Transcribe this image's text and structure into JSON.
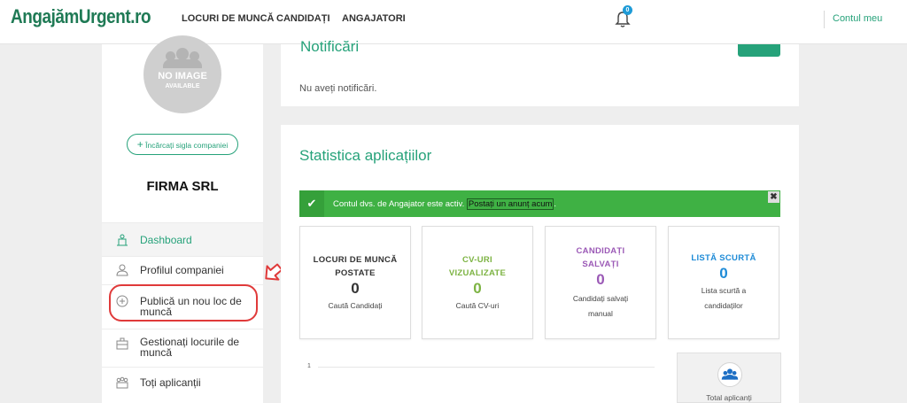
{
  "header": {
    "logo": "AngajămUrgent.ro",
    "nav": [
      "LOCURI DE MUNCĂ",
      "CANDIDAȚI",
      "ANGAJATORI"
    ],
    "notification_count": "0",
    "account": "Contul meu"
  },
  "sidebar": {
    "avatar_line1": "NO IMAGE",
    "avatar_line2": "AVAILABLE",
    "upload_button": "Încărcați sigla companiei",
    "company_name": "FIRMA SRL",
    "items": [
      {
        "label": "Dashboard",
        "icon": "dashboard-icon"
      },
      {
        "label": "Profilul companiei",
        "icon": "user-icon"
      },
      {
        "label": "Publică un nou loc de muncă",
        "icon": "plus-circle-icon"
      },
      {
        "label": "Gestionați locurile de muncă",
        "icon": "briefcase-icon"
      },
      {
        "label": "Toți aplicanții",
        "icon": "users-icon"
      }
    ]
  },
  "notifications": {
    "title": "Notificări",
    "empty_text": "Nu aveți notificări."
  },
  "stats": {
    "title": "Statistica aplicațiilor",
    "alert_text": "Contul dvs. de Angajator este activ.",
    "alert_link": "Postați un anunț acum",
    "alert_suffix": ".",
    "close_label": "✖",
    "cards": [
      {
        "title": "LOCURI DE MUNCĂ POSTATE",
        "value": "0",
        "link": "Caută Candidați",
        "color": "#333333"
      },
      {
        "title": "CV-URI VIZUALIZATE",
        "value": "0",
        "link": "Caută CV-uri",
        "color": "#7cb342"
      },
      {
        "title": "CANDIDAȚI SALVAȚI",
        "value": "0",
        "link": "Candidați salvați manual",
        "color": "#9b59b6"
      },
      {
        "title": "LISTĂ SCURTĂ",
        "value": "0",
        "link": "Lista scurtă a candidaților",
        "color": "#1e8bd7"
      }
    ],
    "chart_tick": "1",
    "total_label": "Total aplicanți"
  },
  "colors": {
    "brand": "#26a27a",
    "alert": "#3fb144",
    "highlight": "#e03a3a"
  }
}
